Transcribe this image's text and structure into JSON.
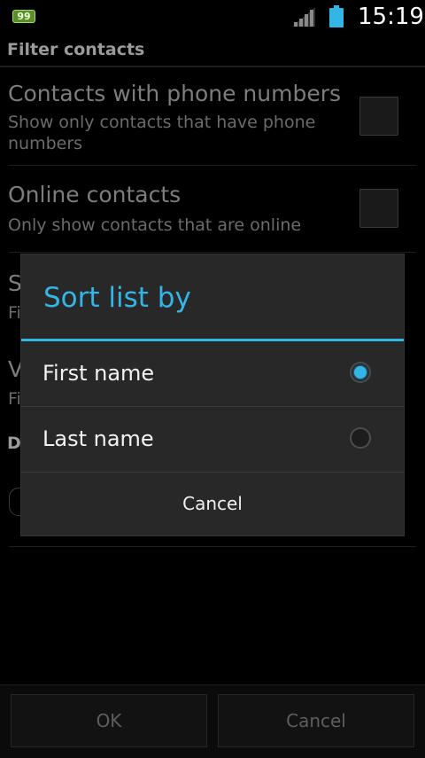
{
  "status_bar": {
    "notification_badge": "99",
    "clock": "15:19",
    "icons": [
      "signal-icon",
      "battery-icon"
    ],
    "accent_color": "#33b5e5"
  },
  "settings": {
    "section_filter": "Filter contacts",
    "pref_phone": {
      "title": "Contacts with phone numbers",
      "summary": "Show only contacts that have phone numbers",
      "checked": false
    },
    "pref_online": {
      "title": "Online contacts",
      "summary": "Only show contacts that are online",
      "checked": false
    },
    "obscured_fragments": {
      "sort_title_initial": "S",
      "sort_summary_initial": "Fi",
      "view_title_initial": "V",
      "view_summary_initial": "Fi",
      "display_header_initial": "Di"
    }
  },
  "bottom_buttons": {
    "ok": "OK",
    "cancel": "Cancel"
  },
  "dialog": {
    "title": "Sort list by",
    "options": [
      {
        "label": "First name",
        "selected": true
      },
      {
        "label": "Last name",
        "selected": false
      }
    ],
    "cancel": "Cancel"
  }
}
